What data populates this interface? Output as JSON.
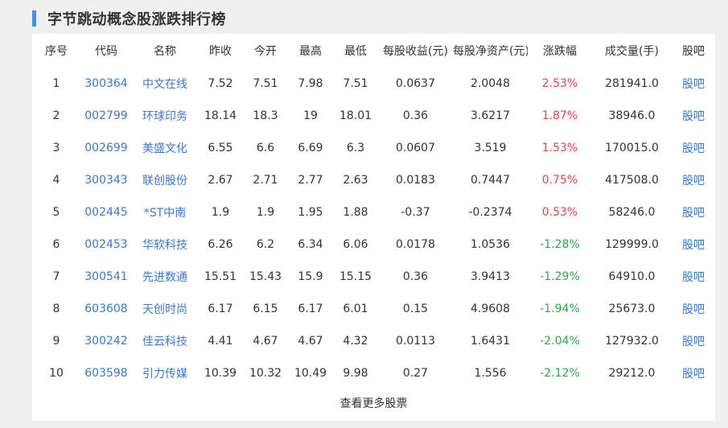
{
  "title": "字节跳动概念股涨跌排行榜",
  "columns": [
    "序号",
    "代码",
    "名称",
    "昨收",
    "今开",
    "最高",
    "最低",
    "每股收益(元)",
    "每股净资产(元)",
    "涨跌幅",
    "成交量(手)",
    "股吧"
  ],
  "rows": [
    {
      "no": "1",
      "code": "300364",
      "name": "中文在线",
      "prev": "7.52",
      "open": "7.51",
      "high": "7.98",
      "low": "7.51",
      "eps": "0.0637",
      "bvps": "2.0048",
      "chg": "2.53%",
      "dir": "up",
      "vol": "281941.0",
      "bar": "股吧"
    },
    {
      "no": "2",
      "code": "002799",
      "name": "环球印务",
      "prev": "18.14",
      "open": "18.3",
      "high": "19",
      "low": "18.01",
      "eps": "0.36",
      "bvps": "3.6217",
      "chg": "1.87%",
      "dir": "up",
      "vol": "38946.0",
      "bar": "股吧"
    },
    {
      "no": "3",
      "code": "002699",
      "name": "美盛文化",
      "prev": "6.55",
      "open": "6.6",
      "high": "6.69",
      "low": "6.3",
      "eps": "0.0607",
      "bvps": "3.519",
      "chg": "1.53%",
      "dir": "up",
      "vol": "170015.0",
      "bar": "股吧"
    },
    {
      "no": "4",
      "code": "300343",
      "name": "联创股份",
      "prev": "2.67",
      "open": "2.71",
      "high": "2.77",
      "low": "2.63",
      "eps": "0.0183",
      "bvps": "0.7447",
      "chg": "0.75%",
      "dir": "up",
      "vol": "417508.0",
      "bar": "股吧"
    },
    {
      "no": "5",
      "code": "002445",
      "name": "*ST中南",
      "prev": "1.9",
      "open": "1.9",
      "high": "1.95",
      "low": "1.88",
      "eps": "-0.37",
      "bvps": "-0.2374",
      "chg": "0.53%",
      "dir": "up",
      "vol": "58246.0",
      "bar": "股吧"
    },
    {
      "no": "6",
      "code": "002453",
      "name": "华软科技",
      "prev": "6.26",
      "open": "6.2",
      "high": "6.34",
      "low": "6.06",
      "eps": "0.0178",
      "bvps": "1.0536",
      "chg": "-1.28%",
      "dir": "down",
      "vol": "129999.0",
      "bar": "股吧"
    },
    {
      "no": "7",
      "code": "300541",
      "name": "先进数通",
      "prev": "15.51",
      "open": "15.43",
      "high": "15.9",
      "low": "15.15",
      "eps": "0.36",
      "bvps": "3.9413",
      "chg": "-1.29%",
      "dir": "down",
      "vol": "64910.0",
      "bar": "股吧"
    },
    {
      "no": "8",
      "code": "603608",
      "name": "天创时尚",
      "prev": "6.17",
      "open": "6.15",
      "high": "6.17",
      "low": "6.01",
      "eps": "0.15",
      "bvps": "4.9608",
      "chg": "-1.94%",
      "dir": "down",
      "vol": "25673.0",
      "bar": "股吧"
    },
    {
      "no": "9",
      "code": "300242",
      "name": "佳云科技",
      "prev": "4.41",
      "open": "4.67",
      "high": "4.67",
      "low": "4.32",
      "eps": "0.0113",
      "bvps": "1.6431",
      "chg": "-2.04%",
      "dir": "down",
      "vol": "127932.0",
      "bar": "股吧"
    },
    {
      "no": "10",
      "code": "603598",
      "name": "引力传媒",
      "prev": "10.39",
      "open": "10.32",
      "high": "10.49",
      "low": "9.98",
      "eps": "0.27",
      "bvps": "1.556",
      "chg": "-2.12%",
      "dir": "down",
      "vol": "29212.0",
      "bar": "股吧"
    }
  ],
  "more_label": "查看更多股票",
  "colors": {
    "accent": "#4a90d9",
    "link": "#3d77c9",
    "up": "#e04545",
    "down": "#2fa54a"
  }
}
